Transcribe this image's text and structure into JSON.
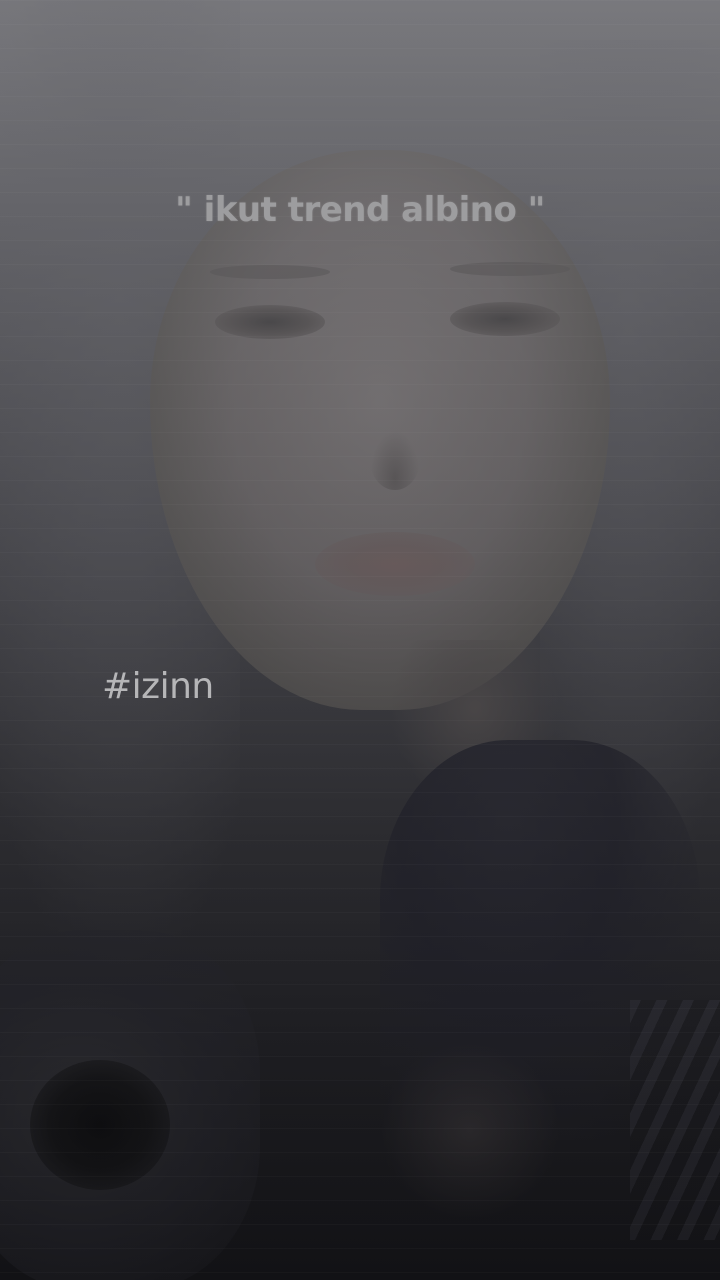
{
  "overlay_text": {
    "caption": "\" ikut trend albino \"",
    "hashtag": "#izinn"
  },
  "colors": {
    "caption_text": "#9d9d9f",
    "hashtag_text": "#b6b6b8",
    "background_top": "#6e6e72",
    "background_bottom": "#16161a"
  }
}
